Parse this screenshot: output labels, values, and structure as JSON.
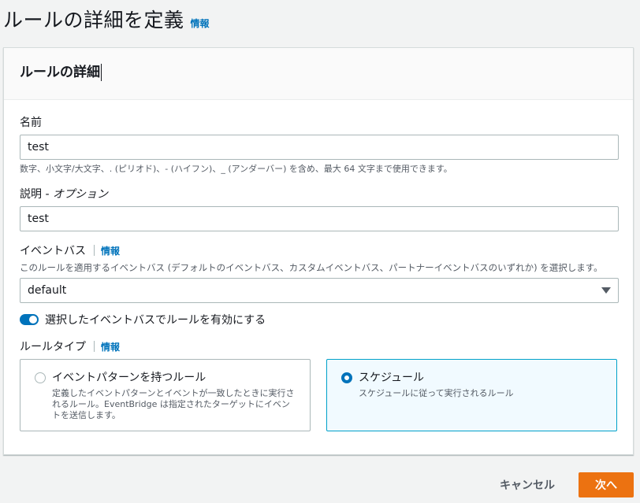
{
  "page": {
    "title": "ルールの詳細を定義",
    "info": "情報"
  },
  "panel": {
    "title": "ルールの詳細"
  },
  "name": {
    "label": "名前",
    "value": "test",
    "help": "数字、小文字/大文字、. (ピリオド)、- (ハイフン)、_ (アンダーバー) を含め、最大 64 文字まで使用できます。"
  },
  "description": {
    "label": "説明 - ",
    "label_opt": "オプション",
    "value": "test"
  },
  "event_bus": {
    "label": "イベントバス",
    "info": "情報",
    "help": "このルールを適用するイベントバス (デフォルトのイベントバス、カスタムイベントバス、パートナーイベントバスのいずれか) を選択します。",
    "selected": "default"
  },
  "toggle": {
    "label": "選択したイベントバスでルールを有効にする",
    "enabled": true
  },
  "rule_type": {
    "label": "ルールタイプ",
    "info": "情報",
    "options": [
      {
        "title": "イベントパターンを持つルール",
        "desc": "定義したイベントパターンとイベントが一致したときに実行されるルール。EventBridge は指定されたターゲットにイベントを送信します。",
        "selected": false
      },
      {
        "title": "スケジュール",
        "desc": "スケジュールに従って実行されるルール",
        "selected": true
      }
    ]
  },
  "footer": {
    "cancel": "キャンセル",
    "next": "次へ"
  },
  "colors": {
    "accent": "#0073bb",
    "primary_button": "#ec7211",
    "selected_tile_border": "#00a1c9"
  }
}
